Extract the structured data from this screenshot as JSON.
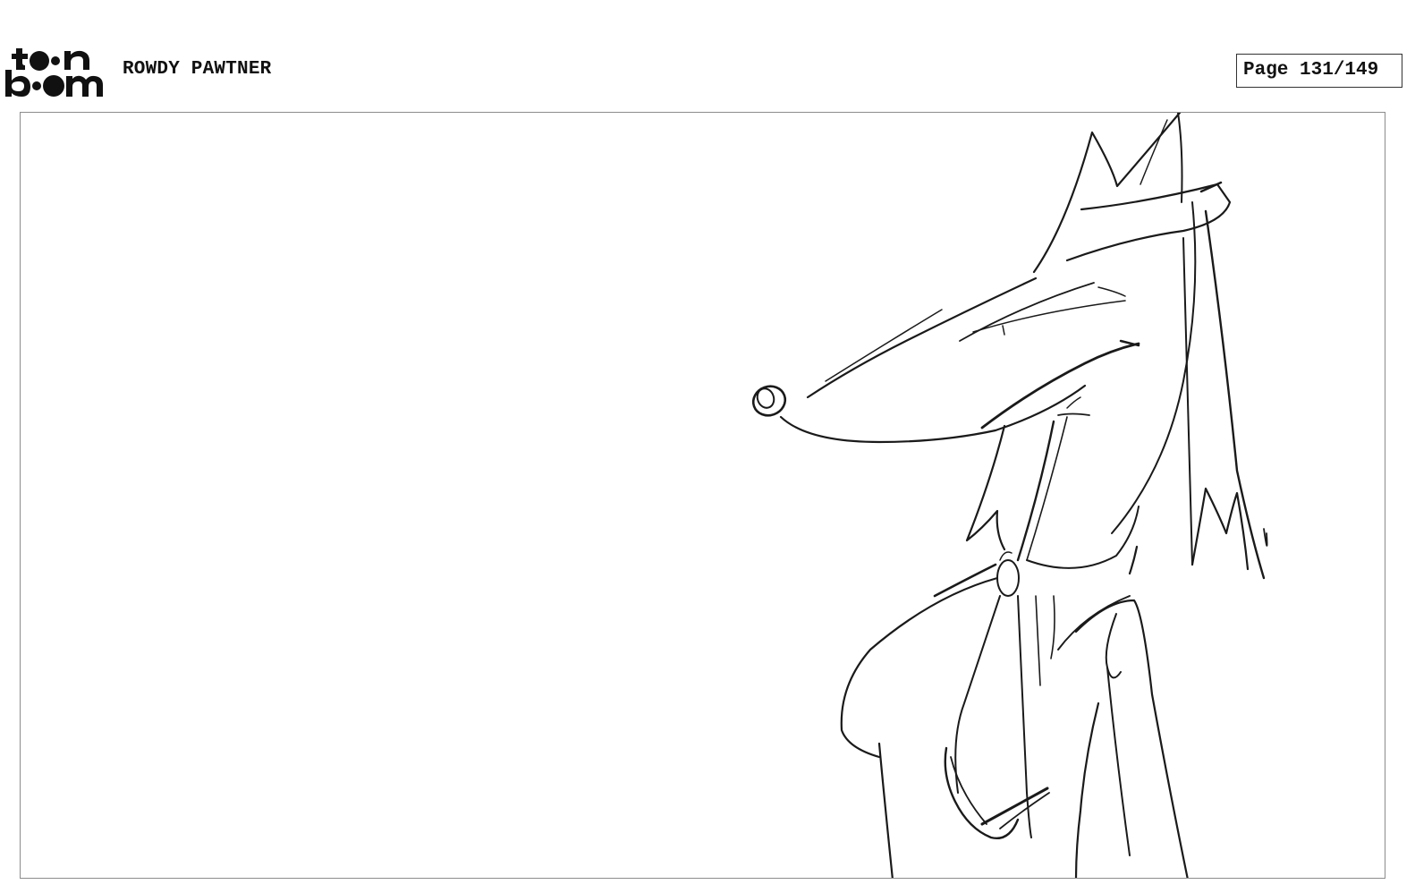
{
  "header": {
    "logo_text_top": "toon",
    "logo_text_bottom": "boom",
    "project_title": "ROWDY PAWTNER",
    "page_indicator": "Page 131/149"
  },
  "panel": {
    "drawing": "wolf-character-sketch-icon"
  }
}
